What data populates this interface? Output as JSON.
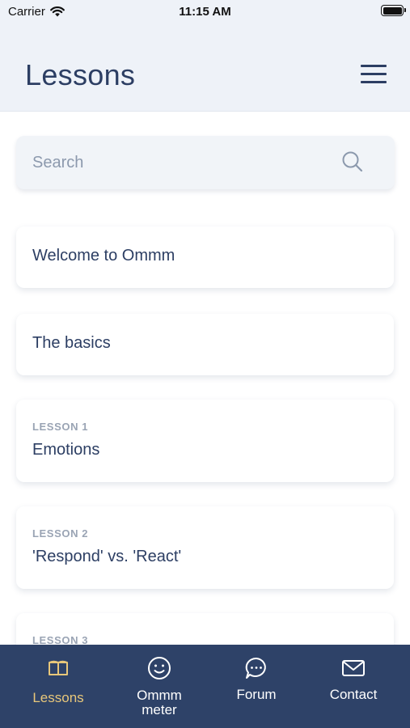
{
  "status_bar": {
    "carrier": "Carrier",
    "time": "11:15 AM"
  },
  "header": {
    "title": "Lessons"
  },
  "search": {
    "placeholder": "Search"
  },
  "lessons": [
    {
      "subtitle": "",
      "title": "Welcome to Ommm"
    },
    {
      "subtitle": "",
      "title": "The basics"
    },
    {
      "subtitle": "LESSON 1",
      "title": "Emotions"
    },
    {
      "subtitle": "LESSON 2",
      "title": "'Respond' vs. 'React'"
    },
    {
      "subtitle": "LESSON 3",
      "title": ""
    }
  ],
  "tabs": [
    {
      "label": "Lessons",
      "icon": "book-icon",
      "active": true
    },
    {
      "label": "Ommm meter",
      "icon": "smiley-icon",
      "active": false
    },
    {
      "label": "Forum",
      "icon": "chat-bubble-icon",
      "active": false
    },
    {
      "label": "Contact",
      "icon": "mail-icon",
      "active": false
    }
  ],
  "colors": {
    "primary": "#2c3e63",
    "tab_bar": "#2e4268",
    "active_tab": "#e8c77a",
    "header_bg": "#eef2f8"
  }
}
